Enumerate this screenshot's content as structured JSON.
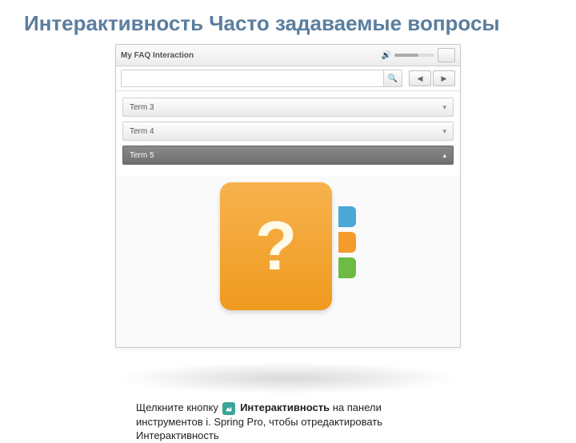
{
  "page": {
    "title": "Интерактивность Часто задаваемые вопросы"
  },
  "app": {
    "title": "My FAQ Interaction",
    "nav_prev": "◀",
    "nav_next": "▶",
    "search_placeholder": "",
    "terms": [
      {
        "label": "Term 3",
        "expanded": false
      },
      {
        "label": "Term 4",
        "expanded": false
      },
      {
        "label": "Term 5",
        "expanded": true
      }
    ]
  },
  "instruction": {
    "prefix": "Щелкните кнопку ",
    "bold": "Интерактивность",
    "mid": " на панели инструментов i. Spring Pro, чтобы отредактировать Интерактивность"
  }
}
